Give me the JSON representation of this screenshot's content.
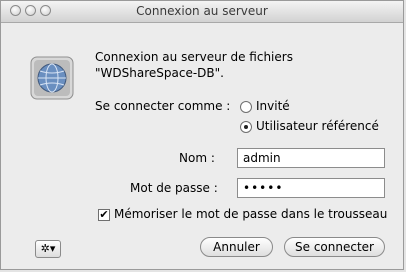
{
  "window": {
    "title": "Connexion au serveur"
  },
  "message": {
    "line1": "Connexion au serveur de fichiers",
    "line2": "\"WDShareSpace-DB\"."
  },
  "connect_as": {
    "label": "Se connecter comme :",
    "options": [
      {
        "label": "Invité",
        "selected": false
      },
      {
        "label": "Utilisateur référencé",
        "selected": true
      }
    ]
  },
  "fields": {
    "name_label": "Nom :",
    "name_value": "admin",
    "password_label": "Mot de passe :",
    "password_value": "•••••"
  },
  "remember": {
    "label": "Mémoriser le mot de passe dans le trousseau",
    "checked": true,
    "check_mark": "✔"
  },
  "buttons": {
    "gear_glyph": "✲▾",
    "cancel": "Annuler",
    "connect": "Se connecter"
  },
  "icons": {
    "server": "globe-server-icon",
    "gear": "gear-icon"
  }
}
